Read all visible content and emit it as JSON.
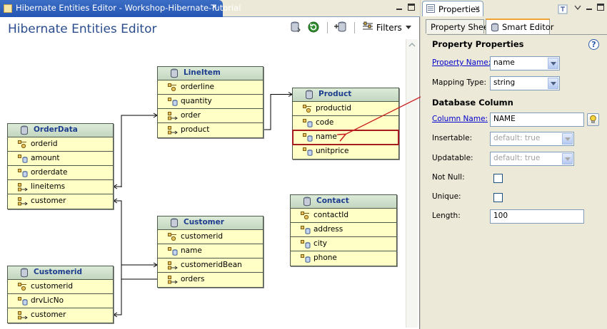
{
  "editor": {
    "tab_title": "Hibernate Entities Editor - Workshop-Hibernate-Tutorial",
    "close_glyph": "✕",
    "header_title": "Hibernate Entities Editor",
    "filters_label": "Filters"
  },
  "entities": [
    {
      "id": "lineitem",
      "name": "LineItem",
      "props": [
        {
          "name": "orderline",
          "icon": "key-icon"
        },
        {
          "name": "quantity",
          "icon": "column-icon"
        },
        {
          "name": "order",
          "icon": "relation-icon"
        },
        {
          "name": "product",
          "icon": "relation-icon"
        }
      ]
    },
    {
      "id": "product",
      "name": "Product",
      "props": [
        {
          "name": "productid",
          "icon": "key-icon"
        },
        {
          "name": "code",
          "icon": "column-icon"
        },
        {
          "name": "name",
          "icon": "column-icon",
          "selected": true
        },
        {
          "name": "unitprice",
          "icon": "column-icon"
        }
      ]
    },
    {
      "id": "orderdata",
      "name": "OrderData",
      "props": [
        {
          "name": "orderid",
          "icon": "key-icon"
        },
        {
          "name": "amount",
          "icon": "column-icon"
        },
        {
          "name": "orderdate",
          "icon": "column-icon"
        },
        {
          "name": "lineitems",
          "icon": "relation-icon"
        },
        {
          "name": "customer",
          "icon": "relation-icon"
        }
      ]
    },
    {
      "id": "contact",
      "name": "Contact",
      "props": [
        {
          "name": "contactId",
          "icon": "key-icon"
        },
        {
          "name": "address",
          "icon": "column-icon"
        },
        {
          "name": "city",
          "icon": "column-icon"
        },
        {
          "name": "phone",
          "icon": "column-icon"
        }
      ]
    },
    {
      "id": "customer",
      "name": "Customer",
      "props": [
        {
          "name": "customerid",
          "icon": "key-icon"
        },
        {
          "name": "name",
          "icon": "column-icon"
        },
        {
          "name": "customeridBean",
          "icon": "relation-icon"
        },
        {
          "name": "orders",
          "icon": "relation-icon"
        }
      ]
    },
    {
      "id": "customerid",
      "name": "Customerid",
      "props": [
        {
          "name": "customerid",
          "icon": "key-icon"
        },
        {
          "name": "drvLicNo",
          "icon": "column-icon"
        },
        {
          "name": "customer",
          "icon": "relation-icon"
        }
      ]
    }
  ],
  "properties_view": {
    "tab_title": "Properties",
    "close_glyph": "✕",
    "subtabs": [
      "Property Sheet",
      "Smart Editor"
    ],
    "active_subtab": "Smart Editor",
    "section_property": "Property Properties",
    "help_glyph": "?",
    "property_name_label": "Property Name:",
    "property_name_value": "name",
    "mapping_type_label": "Mapping Type:",
    "mapping_type_value": "string",
    "section_column": "Database Column",
    "column_name_label": "Column Name:",
    "column_name_value": "NAME",
    "insertable_label": "Insertable:",
    "insertable_value": "default: true",
    "updatable_label": "Updatable:",
    "updatable_value": "default: true",
    "not_null_label": "Not Null:",
    "unique_label": "Unique:",
    "length_label": "Length:",
    "length_value": "100"
  },
  "colors": {
    "relation_line": "#000000",
    "selection_arrow": "#cc1f1f",
    "header_title": "#2b4d8e",
    "entity_name": "#1d3d8e"
  }
}
